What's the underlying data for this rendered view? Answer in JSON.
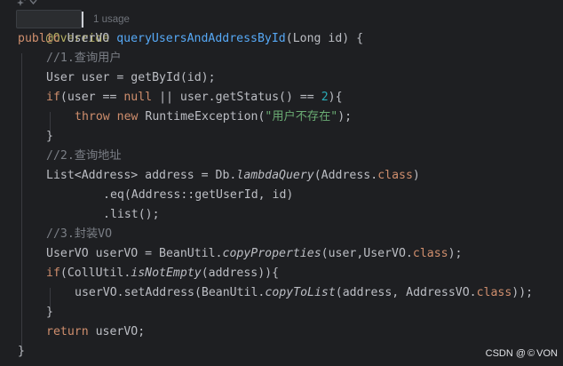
{
  "top_hint": {
    "icons": [
      "sparkle-icon",
      "chevron-down-icon"
    ]
  },
  "code": {
    "override": "@Override",
    "usage": "1 usage",
    "line2": {
      "public": "public",
      "type": "UserVO",
      "method": "queryUsersAndAddressById",
      "params": "(Long id) {"
    },
    "comment1": "//1.查询用户",
    "line4": "User user = getById(id);",
    "line5": {
      "if": "if",
      "part1": "(user == ",
      "null": "null",
      "part2": " || user.getStatus() == ",
      "num": "2",
      "part3": "){"
    },
    "line6": {
      "throw": "throw",
      "new": "new",
      "part1": " RuntimeException(",
      "str": "\"用户不存在\"",
      "part2": ");"
    },
    "brace1": "}",
    "comment2": "//2.查询地址",
    "line9": {
      "part1": "List<Address> address = Db.",
      "method": "lambdaQuery",
      "part2": "(Address.",
      "class": "class",
      "part3": ")"
    },
    "line10": ".eq(Address::getUserId, id)",
    "line11": ".list();",
    "comment3": "//3.封装VO",
    "line13": {
      "part1": "UserVO userVO = BeanUtil.",
      "method": "copyProperties",
      "part2": "(user,UserVO.",
      "class": "class",
      "part3": ");"
    },
    "line14": {
      "if": "if",
      "part1": "(CollUtil.",
      "method": "isNotEmpty",
      "part2": "(address)){"
    },
    "line15": {
      "part1": "userVO.setAddress(BeanUtil.",
      "method": "copyToList",
      "part2": "(address, AddressVO.",
      "class": "class",
      "part3": "));"
    },
    "brace2": "}",
    "line17": {
      "return": "return",
      "rest": " userVO;"
    },
    "brace3": "}"
  },
  "watermark": {
    "prefix": "CSDN @",
    "symbol": "©",
    "name": "VON"
  },
  "colors": {
    "background": "#1e1f22",
    "keyword": "#cf8e6d",
    "annotation": "#b3ae60",
    "method": "#56a8f5",
    "comment": "#7a7e85",
    "number": "#2aacb8",
    "string": "#6aab73",
    "text": "#bcbec4"
  }
}
